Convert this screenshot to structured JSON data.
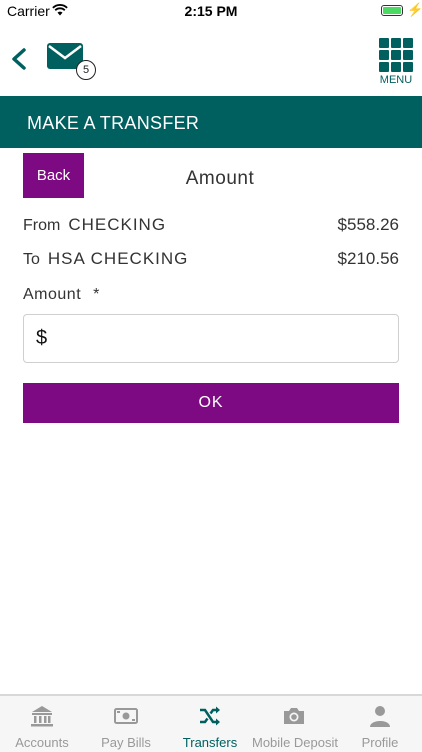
{
  "status_bar": {
    "carrier": "Carrier",
    "time": "2:15 PM"
  },
  "header": {
    "mail_badge_count": "5",
    "menu_label": "MENU"
  },
  "title_bar": {
    "title": "MAKE A TRANSFER"
  },
  "content": {
    "back_label": "Back",
    "heading": "Amount",
    "from": {
      "label": "From",
      "account": "CHECKING",
      "amount": "$558.26"
    },
    "to": {
      "label": "To",
      "account": "HSA CHECKING",
      "amount": "$210.56"
    },
    "amount_field": {
      "label": "Amount",
      "required_mark": "*",
      "currency_symbol": "$",
      "value": ""
    },
    "ok_label": "OK"
  },
  "tabbar": {
    "tabs": [
      {
        "label": "Accounts",
        "icon": "bank-icon"
      },
      {
        "label": "Pay Bills",
        "icon": "bill-icon"
      },
      {
        "label": "Transfers",
        "icon": "shuffle-icon",
        "active": true
      },
      {
        "label": "Mobile Deposit",
        "icon": "camera-icon"
      },
      {
        "label": "Profile",
        "icon": "person-icon"
      }
    ]
  },
  "colors": {
    "brand_teal": "#00605f",
    "action_purple": "#7d0a82",
    "inactive_tab": "#999999"
  }
}
